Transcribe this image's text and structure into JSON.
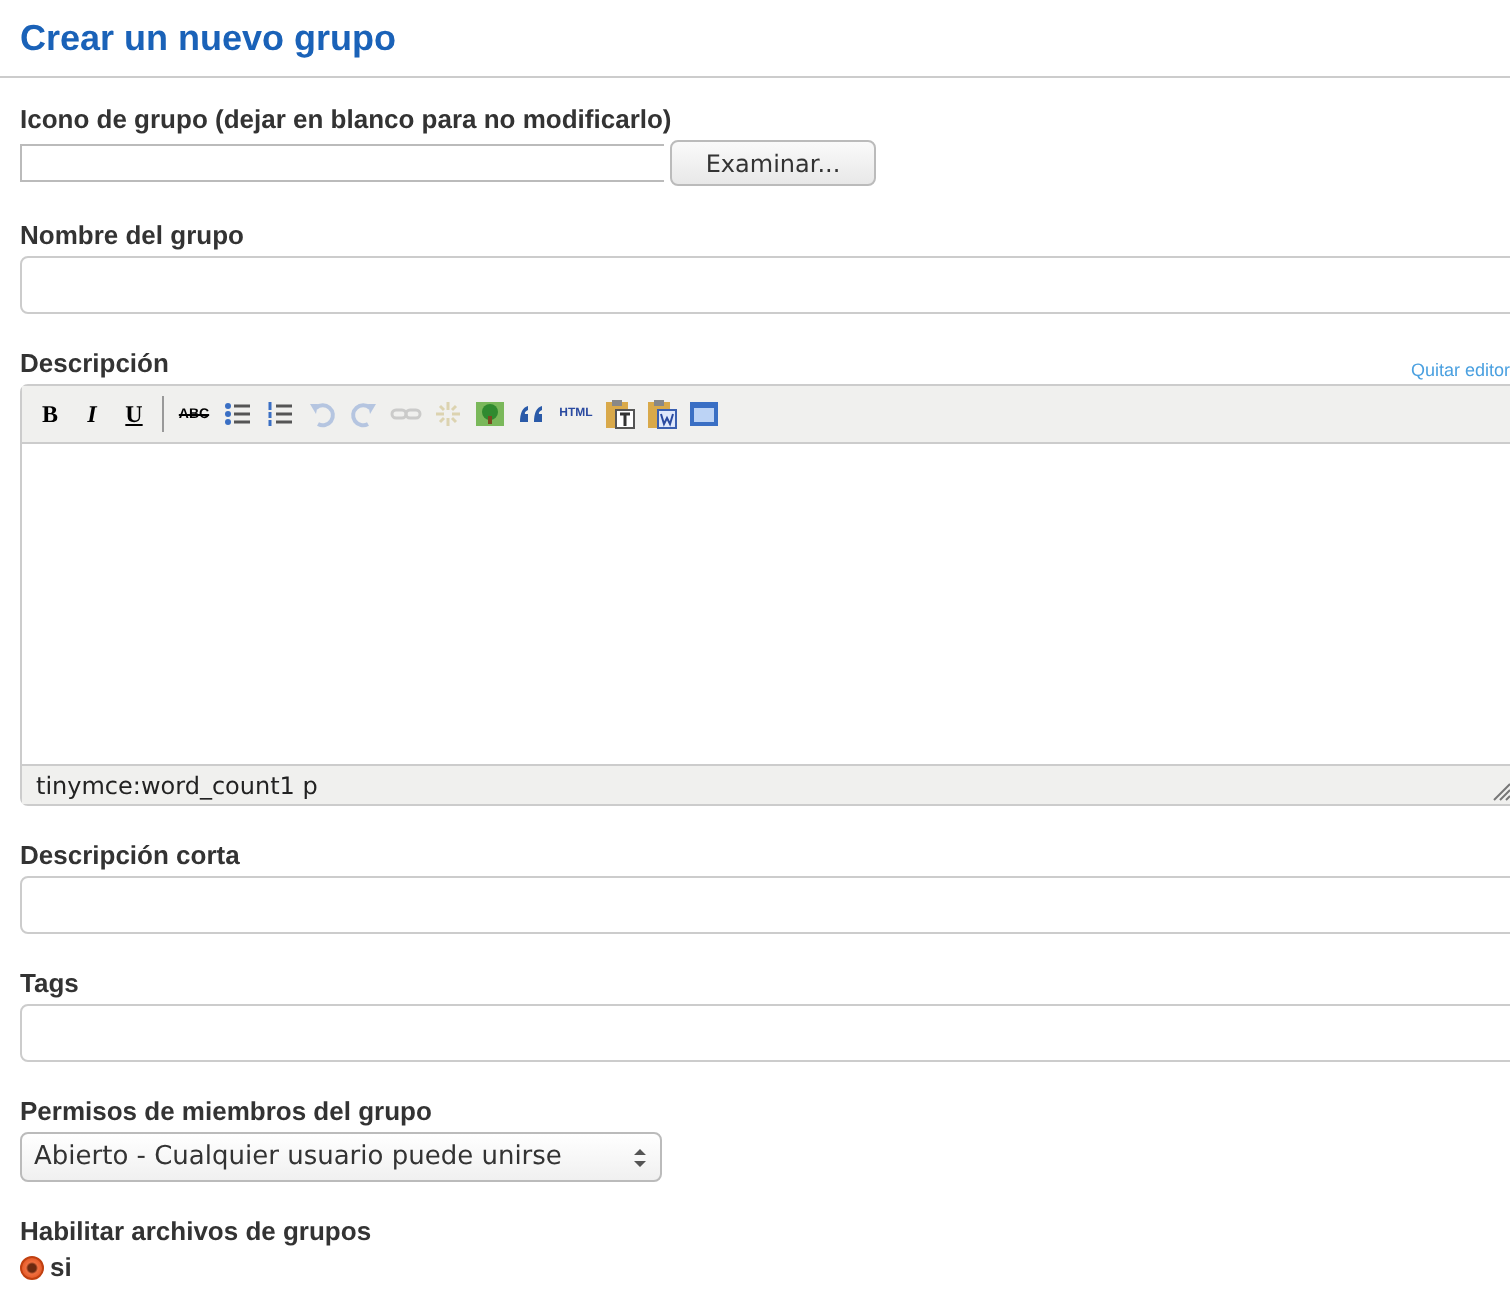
{
  "title": "Crear un nuevo grupo",
  "icon_field": {
    "label": "Icono de grupo (dejar en blanco para no modificarlo)",
    "button": "Examinar..."
  },
  "name_field": {
    "label": "Nombre del grupo"
  },
  "description": {
    "label": "Descripción",
    "toggle_link": "Quitar editor",
    "status": "tinymce:word_count1 p",
    "toolbar": [
      {
        "kind": "bold",
        "label": "B",
        "disabled": false
      },
      {
        "kind": "italic",
        "label": "I",
        "disabled": false
      },
      {
        "kind": "underline",
        "label": "U",
        "disabled": false
      },
      {
        "kind": "separator"
      },
      {
        "kind": "spellcheck",
        "label": "ABC",
        "disabled": false
      },
      {
        "kind": "bullets",
        "disabled": false
      },
      {
        "kind": "numbers",
        "disabled": false
      },
      {
        "kind": "undo",
        "disabled": true
      },
      {
        "kind": "redo",
        "disabled": true
      },
      {
        "kind": "link",
        "disabled": true
      },
      {
        "kind": "unlink",
        "disabled": true
      },
      {
        "kind": "image",
        "disabled": false
      },
      {
        "kind": "quote",
        "disabled": false
      },
      {
        "kind": "html",
        "label": "HTML",
        "disabled": false
      },
      {
        "kind": "paste-text",
        "disabled": false
      },
      {
        "kind": "paste-word",
        "disabled": false
      },
      {
        "kind": "fullscreen",
        "disabled": false
      }
    ]
  },
  "short_description": {
    "label": "Descripción corta"
  },
  "tags": {
    "label": "Tags"
  },
  "permissions": {
    "label": "Permisos de miembros del grupo",
    "value": "Abierto - Cualquier usuario puede unirse"
  },
  "files": {
    "label": "Habilitar archivos de grupos",
    "options": [
      {
        "label": "si",
        "selected": true
      }
    ]
  }
}
